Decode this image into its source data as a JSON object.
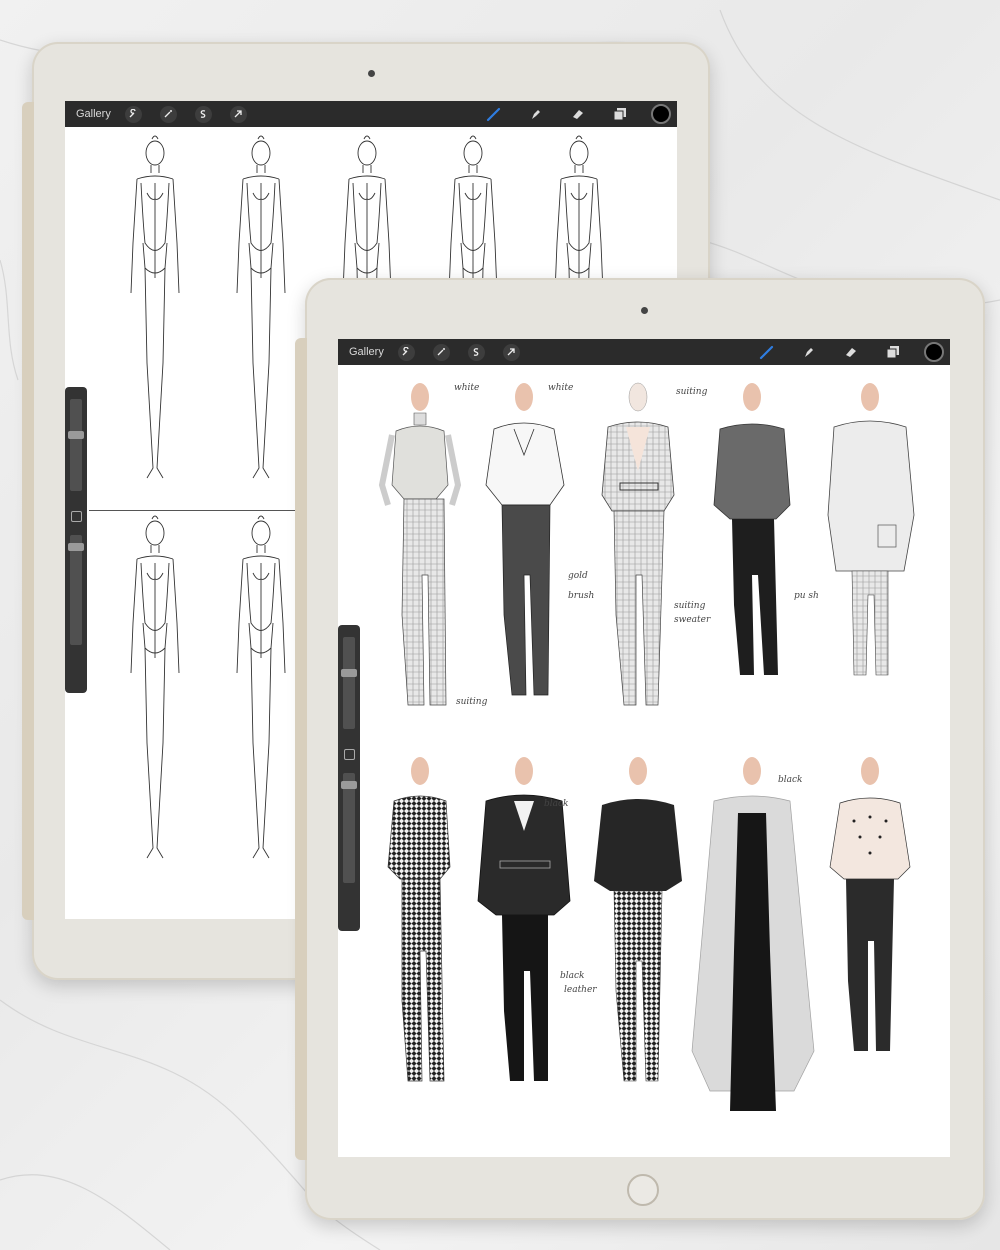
{
  "colors": {
    "skin": "#e9c2ad",
    "ink": "#2a2a2a",
    "toolbar": "#2b2b2b",
    "accent": "#2f7de1"
  },
  "back_tablet": {
    "toolbar": {
      "gallery_label": "Gallery",
      "left_tools": [
        "wrench-icon",
        "magic-wand-icon",
        "selection-icon",
        "transform-arrow-icon"
      ],
      "right_tools": [
        "brush-icon",
        "smudge-icon",
        "eraser-icon",
        "layers-icon"
      ],
      "active_color": "#000000"
    }
  },
  "front_tablet": {
    "toolbar": {
      "gallery_label": "Gallery",
      "left_tools": [
        "wrench-icon",
        "magic-wand-icon",
        "selection-icon",
        "transform-arrow-icon"
      ],
      "right_tools": [
        "brush-icon",
        "smudge-icon",
        "eraser-icon",
        "layers-icon"
      ],
      "active_color": "#000000"
    },
    "annotations": {
      "n1": "white",
      "n2": "white",
      "n3": "suiting",
      "n4": "suiting",
      "n5": "suiting",
      "n6": "gold",
      "n7": "brush",
      "n8": "sweater",
      "n9": "pu sh",
      "n10": "black",
      "n11": "black",
      "n12": "black",
      "n13": "leather"
    }
  }
}
